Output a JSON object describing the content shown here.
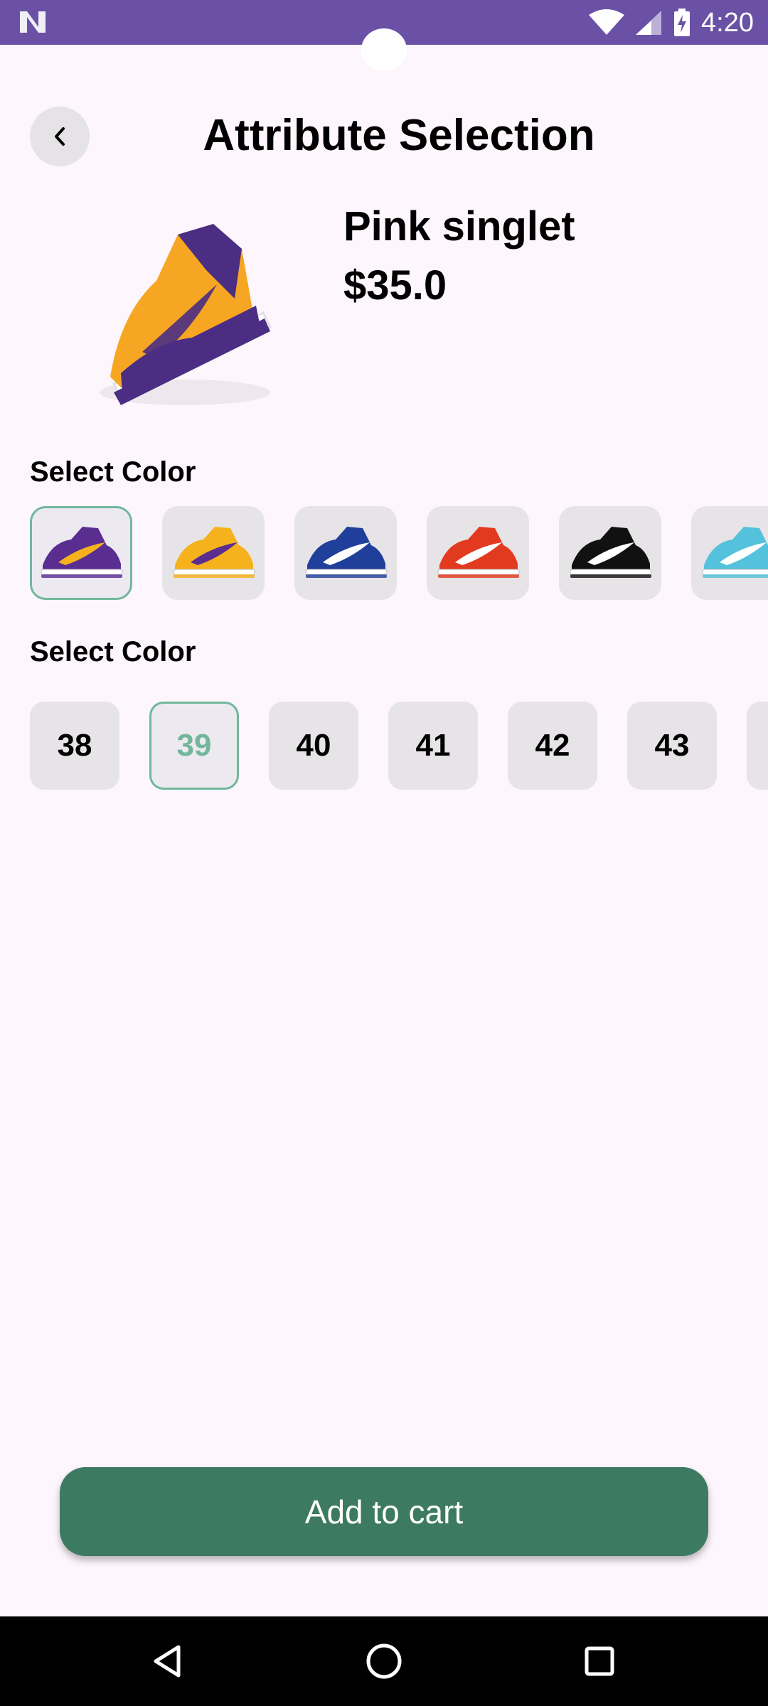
{
  "status_bar": {
    "time": "4:20",
    "icons": [
      "n-logo-icon",
      "wifi-icon",
      "signal-icon",
      "battery-charging-icon"
    ]
  },
  "header": {
    "title": "Attribute Selection",
    "back_icon": "chevron-left-icon"
  },
  "product": {
    "name": "Pink singlet",
    "price": "$35.0",
    "image": "purple-gold-high-top-sneaker"
  },
  "color_section": {
    "label": "Select Color",
    "selected_index": 0,
    "options": [
      {
        "upper": "#5a2d91",
        "accent": "#f5b21c",
        "sole": "#ffffff"
      },
      {
        "upper": "#f5b21c",
        "accent": "#5a2d91",
        "sole": "#ffffff"
      },
      {
        "upper": "#1f3f9a",
        "accent": "#ffffff",
        "sole": "#ffffff"
      },
      {
        "upper": "#e23a1e",
        "accent": "#ffffff",
        "sole": "#ffffff"
      },
      {
        "upper": "#111111",
        "accent": "#ffffff",
        "sole": "#ffffff"
      },
      {
        "upper": "#54c2dc",
        "accent": "#ffffff",
        "sole": "#ffffff"
      }
    ]
  },
  "size_section": {
    "label": "Select Color",
    "selected": "39",
    "options": [
      "38",
      "39",
      "40",
      "41",
      "42",
      "43",
      ""
    ]
  },
  "cta": {
    "label": "Add to cart"
  },
  "navigation": {
    "buttons": [
      "back-triangle-icon",
      "home-circle-icon",
      "recents-square-icon"
    ]
  },
  "colors": {
    "status_bar": "#6a51a6",
    "background": "#fdf6fc",
    "accent": "#3d7a62",
    "selected_outline": "#72b79c",
    "chip": "#e7e4e7"
  }
}
